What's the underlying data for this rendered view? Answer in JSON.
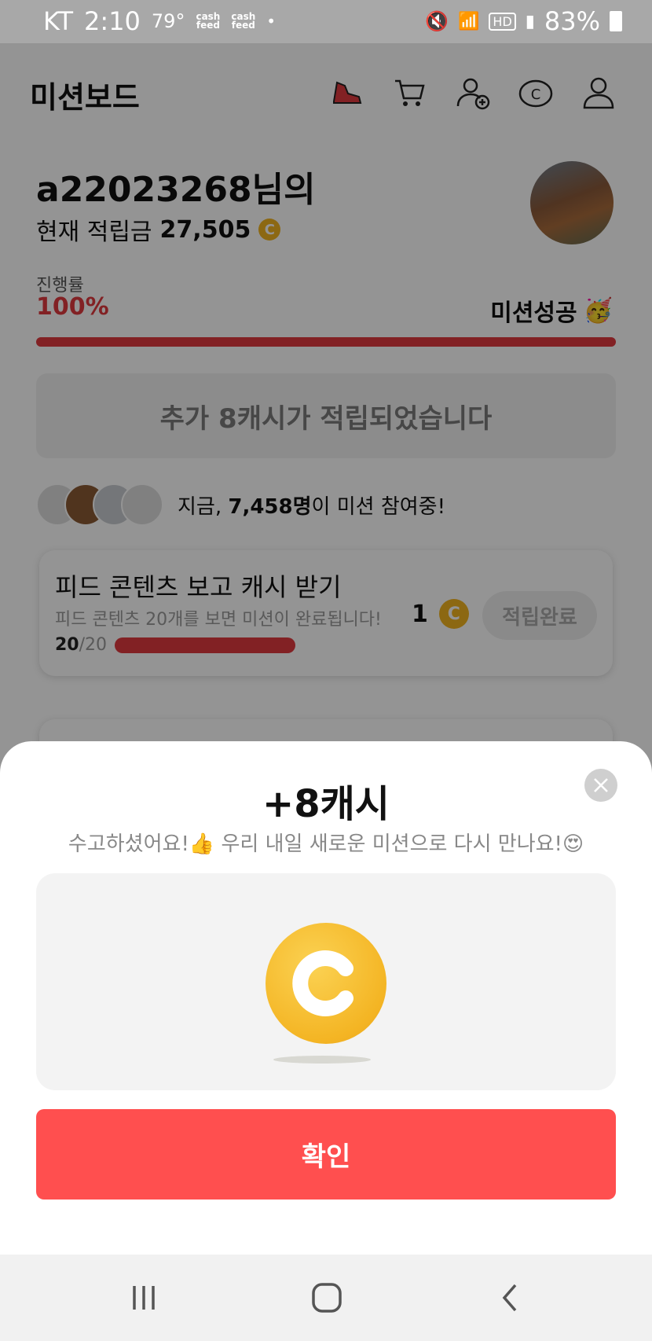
{
  "status_bar": {
    "carrier": "KT",
    "time": "2:10",
    "temperature": "79°",
    "app_notif_1": "cash\nfeed",
    "app_notif_2": "cash\nfeed",
    "battery": "83%"
  },
  "header": {
    "title": "미션보드",
    "icons": [
      "shoe-icon",
      "cart-icon",
      "add-friend-icon",
      "cash-coin-icon",
      "profile-icon"
    ]
  },
  "user": {
    "name_text": "a22023268님의",
    "balance_label": "현재 적립금",
    "balance_value": "27,505"
  },
  "progress": {
    "label": "진행률",
    "value_text": "100%",
    "fraction": 1.0,
    "success_text": "미션성공",
    "success_emoji": "🥳"
  },
  "extra_notice": "추가 8캐시가 적립되었습니다",
  "participants": {
    "prefix": "지금, ",
    "count": "7,458명",
    "suffix": "이 미션 참여중!"
  },
  "mission": {
    "title": "피드 콘텐츠 보고 캐시 받기",
    "description": "피드 콘텐츠 20개를 보면 미션이 완료됩니다!",
    "done_count": "20",
    "total_count": "/20",
    "reward": "1",
    "button_label": "적립완료"
  },
  "modal": {
    "title": "+8캐시",
    "subtitle": "수고하셨어요!👍 우리 내일 새로운 미션으로 다시 만나요!😍",
    "confirm_label": "확인"
  },
  "colors": {
    "accent_red": "#e0393f",
    "button_red": "#ff4f4f",
    "coin_gold": "#f4b524"
  }
}
